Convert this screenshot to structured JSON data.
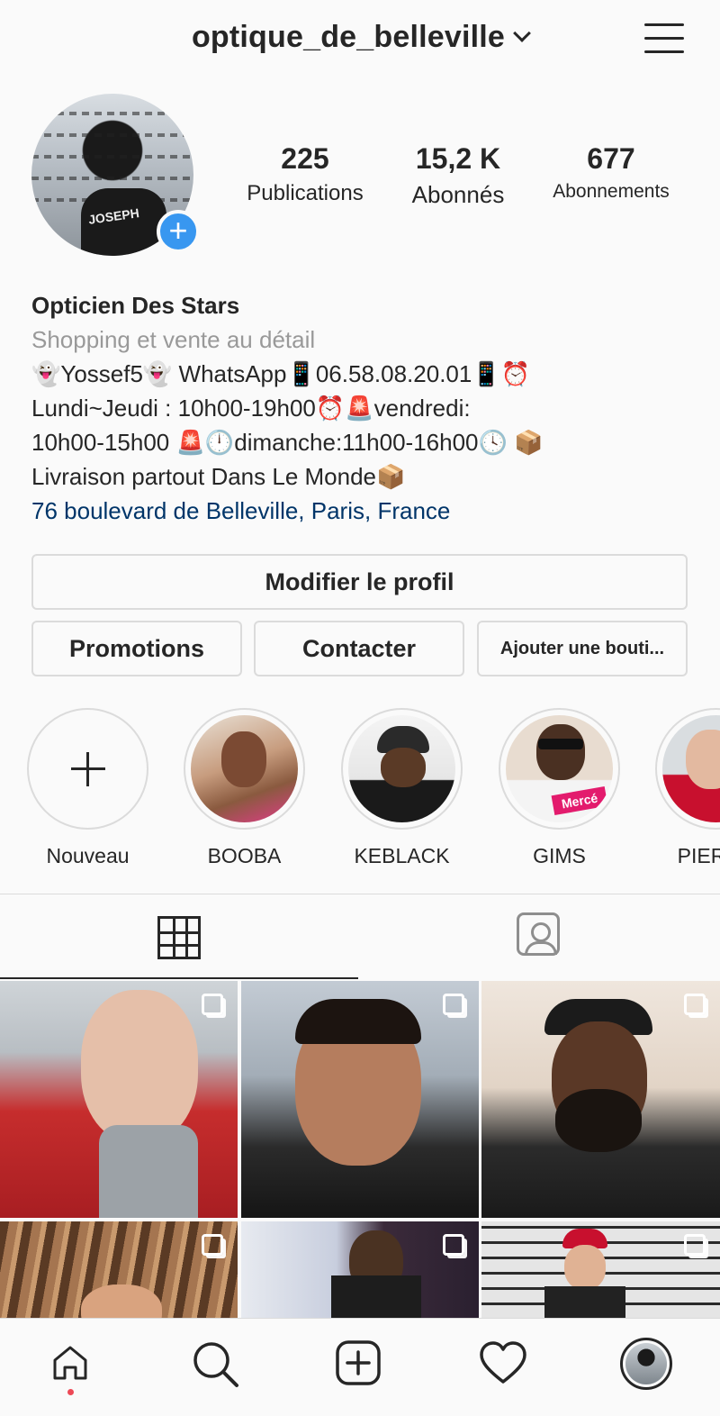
{
  "header": {
    "username": "optique_de_belleville"
  },
  "stats": [
    {
      "value": "225",
      "label": "Publications"
    },
    {
      "value": "15,2 K",
      "label": "Abonnés"
    },
    {
      "value": "677",
      "label": "Abonnements"
    }
  ],
  "avatar": {
    "shirt_text": "JOSEPH"
  },
  "bio": {
    "name": "Opticien Des Stars",
    "category": "Shopping et vente au détail",
    "line1": "👻Yossef5👻 WhatsApp📱06.58.08.20.01📱⏰",
    "line2": "Lundi~Jeudi : 10h00-19h00⏰🚨vendredi:",
    "line3": "10h00-15h00 🚨🕛dimanche:11h00-16h00🕓 📦",
    "line4": "Livraison partout Dans Le Monde📦",
    "address": "76 boulevard de Belleville, Paris, France"
  },
  "buttons": {
    "edit_profile": "Modifier le profil",
    "promotions": "Promotions",
    "contact": "Contacter",
    "add_shop": "Ajouter une bouti..."
  },
  "highlights": [
    {
      "label": "Nouveau"
    },
    {
      "label": "BOOBA"
    },
    {
      "label": "KEBLACK"
    },
    {
      "label": "GIMS"
    },
    {
      "label": "PIERRE"
    }
  ],
  "highlight_texts": {
    "gims_shirt": "Mercé"
  },
  "tabs": {
    "grid": "grid-icon",
    "tagged": "tagged-icon"
  },
  "nav": [
    "home-icon",
    "search-icon",
    "new-post-icon",
    "activity-icon",
    "profile-avatar"
  ],
  "colors": {
    "accent": "#3897f0",
    "link": "#003569",
    "notification": "#ed4956"
  }
}
